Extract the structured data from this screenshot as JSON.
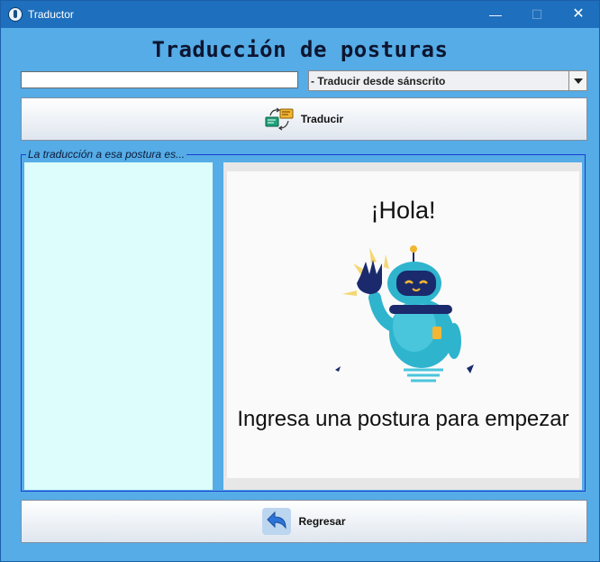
{
  "window": {
    "title": "Traductor"
  },
  "header": {
    "title": "Traducción de posturas"
  },
  "search": {
    "value": "",
    "placeholder": ""
  },
  "mode_select": {
    "selected": "- Traducir desde sánscrito"
  },
  "translate_button": {
    "label": "Traducir",
    "icon": "translate-icon"
  },
  "result_group": {
    "legend": "La traducción a esa postura es..."
  },
  "result_list": {
    "items": []
  },
  "illustration": {
    "greeting": "¡Hola!",
    "prompt": "Ingresa una postura para empezar",
    "icon": "waving-robot-icon"
  },
  "back_button": {
    "label": "Regresar",
    "icon": "back-arrow-icon"
  },
  "colors": {
    "background": "#55ace6",
    "titlebar": "#1e6fbd",
    "list_panel": "#dcfdfb",
    "group_border": "#1b3ed6"
  }
}
